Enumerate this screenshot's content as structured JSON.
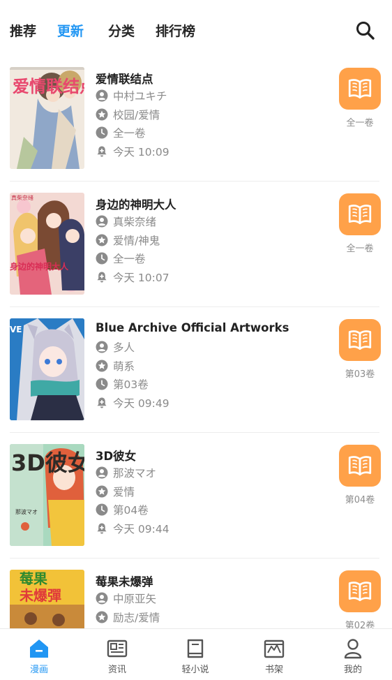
{
  "top_tabs": [
    {
      "label": "推荐",
      "active": false
    },
    {
      "label": "更新",
      "active": true
    },
    {
      "label": "分类",
      "active": false
    },
    {
      "label": "排行榜",
      "active": false
    }
  ],
  "search_icon": "search-icon",
  "colors": {
    "accent": "#2196f3",
    "read_button": "#ffa149",
    "meta_text": "#8a8a8a"
  },
  "comics": [
    {
      "title": "爱情联结点",
      "author": "中村ユキチ",
      "tags": "校园/爱情",
      "volume": "全一卷",
      "updated": "今天 10:09",
      "latest": "全一卷"
    },
    {
      "title": "身边的神明大人",
      "author": "真柴奈绪",
      "tags": "爱情/神鬼",
      "volume": "全一卷",
      "updated": "今天 10:07",
      "latest": "全一卷"
    },
    {
      "title": "Blue Archive Official Artworks",
      "author": "多人",
      "tags": "萌系",
      "volume": "第03卷",
      "updated": "今天 09:49",
      "latest": "第03卷"
    },
    {
      "title": "3D彼女",
      "author": "那波マオ",
      "tags": "爱情",
      "volume": "第04卷",
      "updated": "今天 09:44",
      "latest": "第04卷"
    },
    {
      "title": "莓果未爆弹",
      "author": "中原亚矢",
      "tags": "励志/爱情",
      "volume": "",
      "updated": "",
      "latest": "第02卷"
    }
  ],
  "cover_art_text": {
    "c0": "爱情联结点",
    "c1": "身边的神明大人",
    "c2": "VE",
    "c3": "3D彼女",
    "c3_author": "那波マオ",
    "c4_top": "莓果",
    "c4_bottom": "未爆彈"
  },
  "bottom_nav": [
    {
      "label": "漫画",
      "icon": "home-icon",
      "active": true
    },
    {
      "label": "资讯",
      "icon": "news-icon",
      "active": false
    },
    {
      "label": "轻小说",
      "icon": "book-icon",
      "active": false
    },
    {
      "label": "书架",
      "icon": "bookshelf-icon",
      "active": false
    },
    {
      "label": "我的",
      "icon": "profile-icon",
      "active": false
    }
  ]
}
